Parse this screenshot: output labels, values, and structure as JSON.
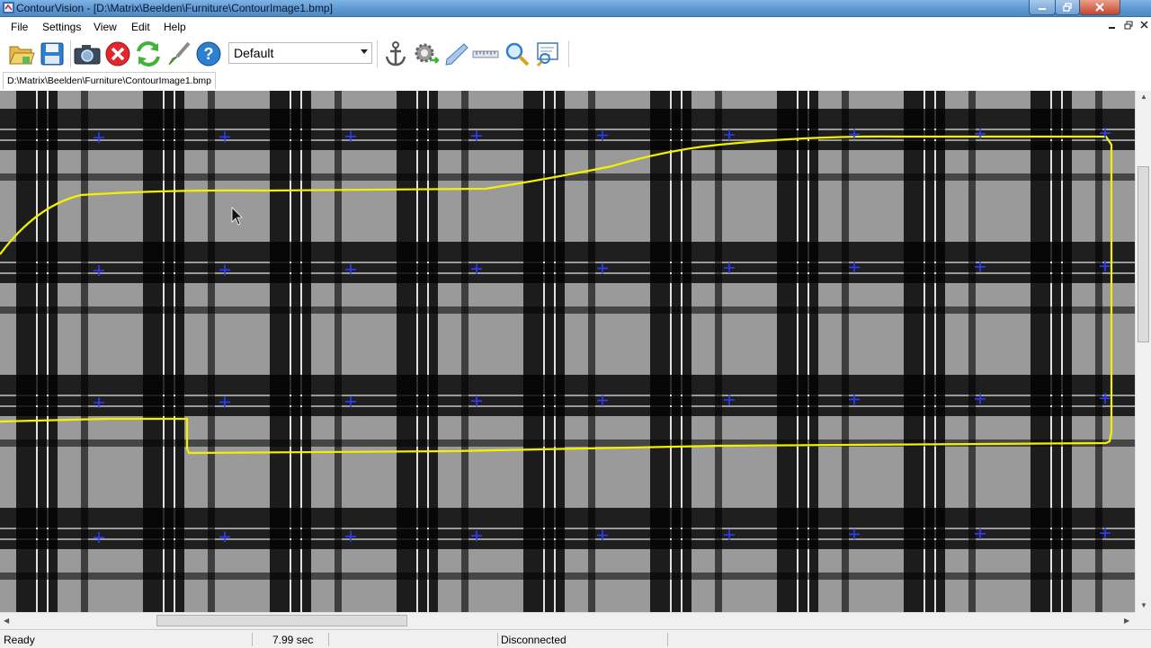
{
  "window": {
    "title": "ContourVision - [D:\\Matrix\\Beelden\\Furniture\\ContourImage1.bmp]"
  },
  "menu": {
    "items": [
      "File",
      "Settings",
      "View",
      "Edit",
      "Help"
    ]
  },
  "toolbar": {
    "icons": [
      "open-folder-icon",
      "save-icon",
      "camera-icon",
      "stop-icon",
      "refresh-icon",
      "brush-icon",
      "help-icon",
      "anchor-icon",
      "settings-gear-icon",
      "pen-icon",
      "ruler-icon",
      "zoom-icon",
      "inspect-icon"
    ],
    "profile_value": "Default"
  },
  "document": {
    "tab_path": "D:\\Matrix\\Beelden\\Furniture\\ContourImage1.bmp"
  },
  "image": {
    "contour_color": "#f2f200",
    "marker_color": "#2a3cff"
  },
  "status": {
    "state": "Ready",
    "time": "7.99 sec",
    "connection": "Disconnected"
  }
}
